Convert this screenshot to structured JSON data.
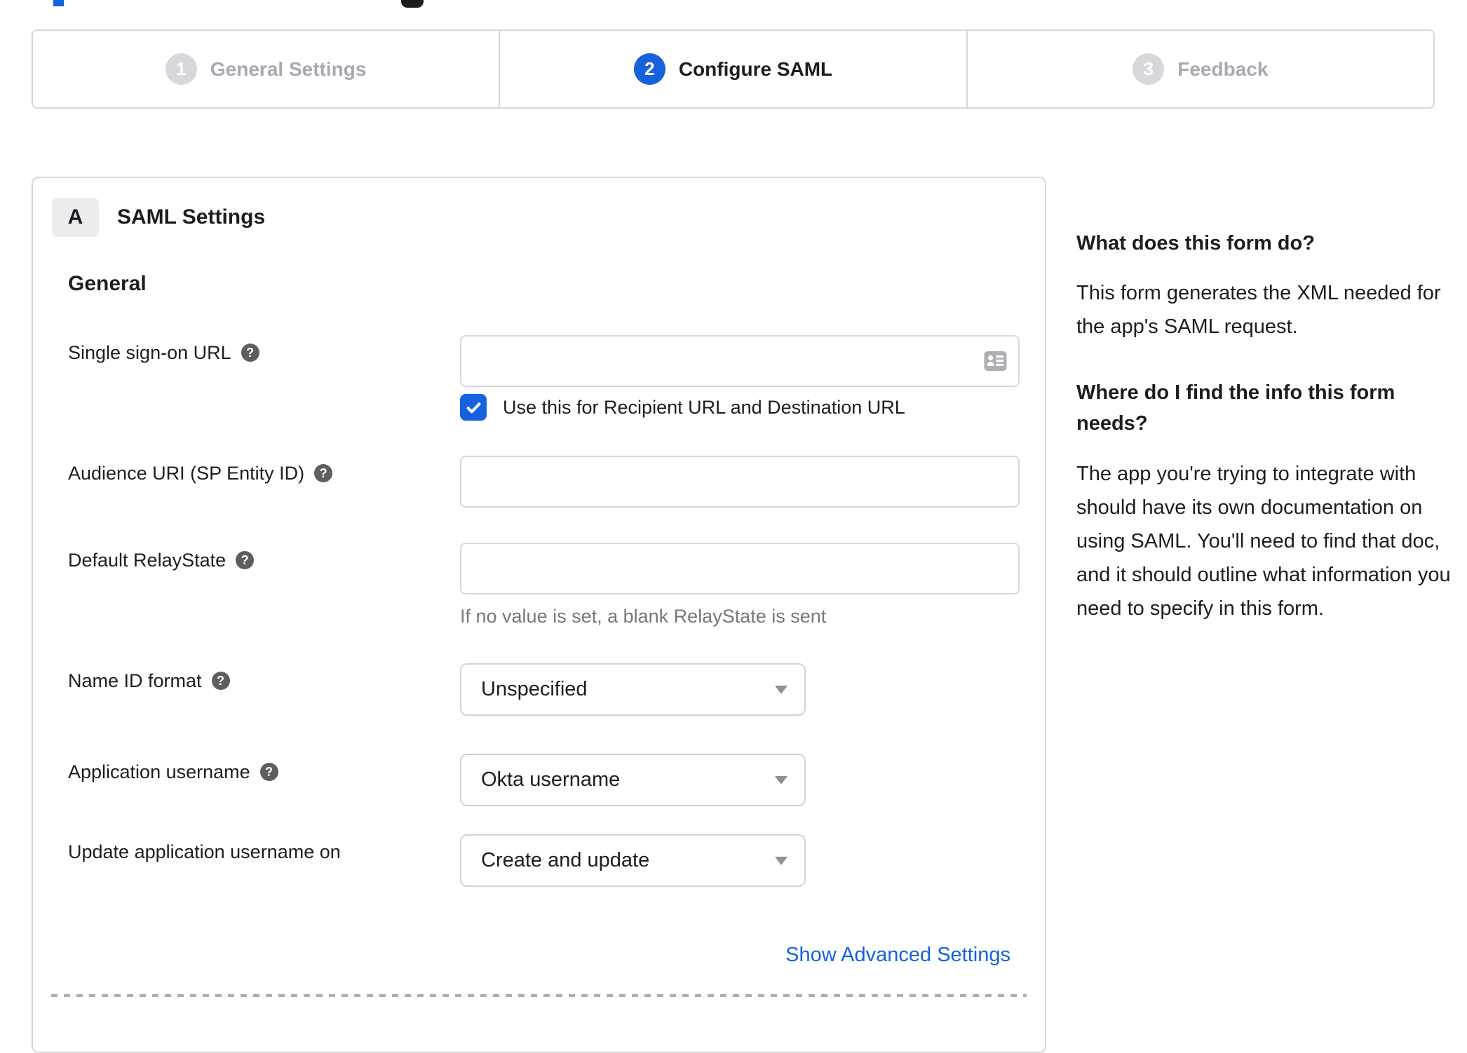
{
  "colors": {
    "accent": "#1662dd",
    "border": "#d8d8dc",
    "text": "#1d1d21",
    "inactive_step": "#a8a8b0",
    "hint": "#76767e",
    "help_icon_bg": "#5e5e5e"
  },
  "stepper": {
    "steps": [
      {
        "number": "1",
        "label": "General Settings",
        "active": false
      },
      {
        "number": "2",
        "label": "Configure SAML",
        "active": true
      },
      {
        "number": "3",
        "label": "Feedback",
        "active": false
      }
    ]
  },
  "saml": {
    "section_badge": "A",
    "section_title": "SAML Settings",
    "general_heading": "General",
    "sso_label": "Single sign-on URL",
    "sso_value": "",
    "sso_checkbox_label": "Use this for Recipient URL and Destination URL",
    "sso_checkbox_checked": true,
    "audience_label": "Audience URI (SP Entity ID)",
    "audience_value": "",
    "relay_label": "Default RelayState",
    "relay_value": "",
    "relay_hint": "If no value is set, a blank RelayState is sent",
    "name_id_label": "Name ID format",
    "name_id_value": "Unspecified",
    "app_username_label": "Application username",
    "app_username_value": "Okta username",
    "update_username_label": "Update application username on",
    "update_username_value": "Create and update",
    "advanced_link": "Show Advanced Settings",
    "help_icon_glyph": "?"
  },
  "sidebar": {
    "q1": "What does this form do?",
    "a1": "This form generates the XML needed for the app's SAML request.",
    "q2": "Where do I find the info this form needs?",
    "a2": "The app you're trying to integrate with should have its own documentation on using SAML. You'll need to find that doc, and it should outline what information you need to specify in this form."
  }
}
